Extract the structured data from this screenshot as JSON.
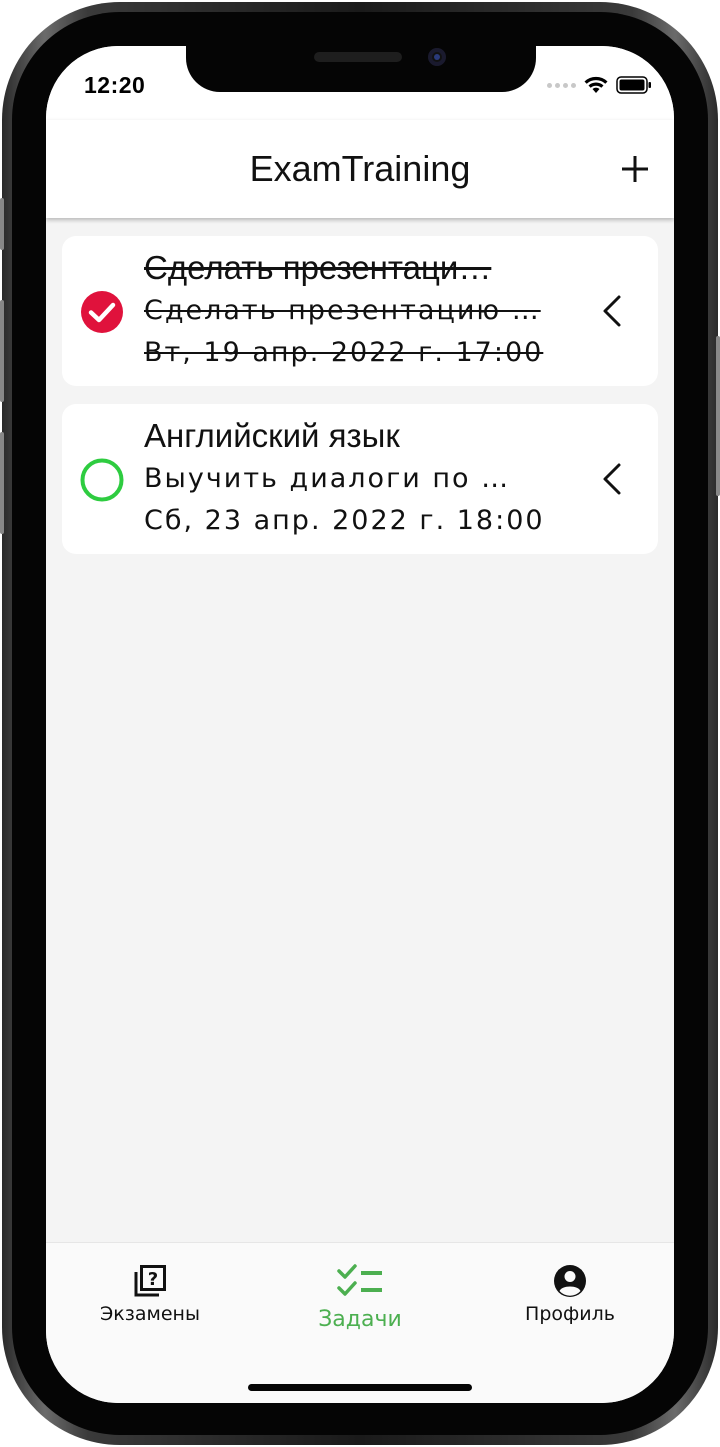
{
  "status_bar": {
    "time": "12:20"
  },
  "app_bar": {
    "title": "ExamTraining",
    "add_icon": "plus-icon"
  },
  "tasks": [
    {
      "title": "Сделать презентаци…",
      "description": "Сделать презентацию …",
      "date": "Вт, 19 апр. 2022 г. 17:00",
      "completed": true,
      "status_color": "#e0123c"
    },
    {
      "title": "Английский язык",
      "description": "Выучить диалоги по …",
      "date": "Сб, 23 апр. 2022 г. 18:00",
      "completed": false,
      "status_color": "#2ecc40"
    }
  ],
  "bottom_nav": {
    "items": [
      {
        "label": "Экзамены",
        "icon": "quiz-library-icon",
        "active": false
      },
      {
        "label": "Задачи",
        "icon": "checklist-icon",
        "active": true
      },
      {
        "label": "Профиль",
        "icon": "account-circle-icon",
        "active": false
      }
    ],
    "active_color": "#4caf50"
  }
}
